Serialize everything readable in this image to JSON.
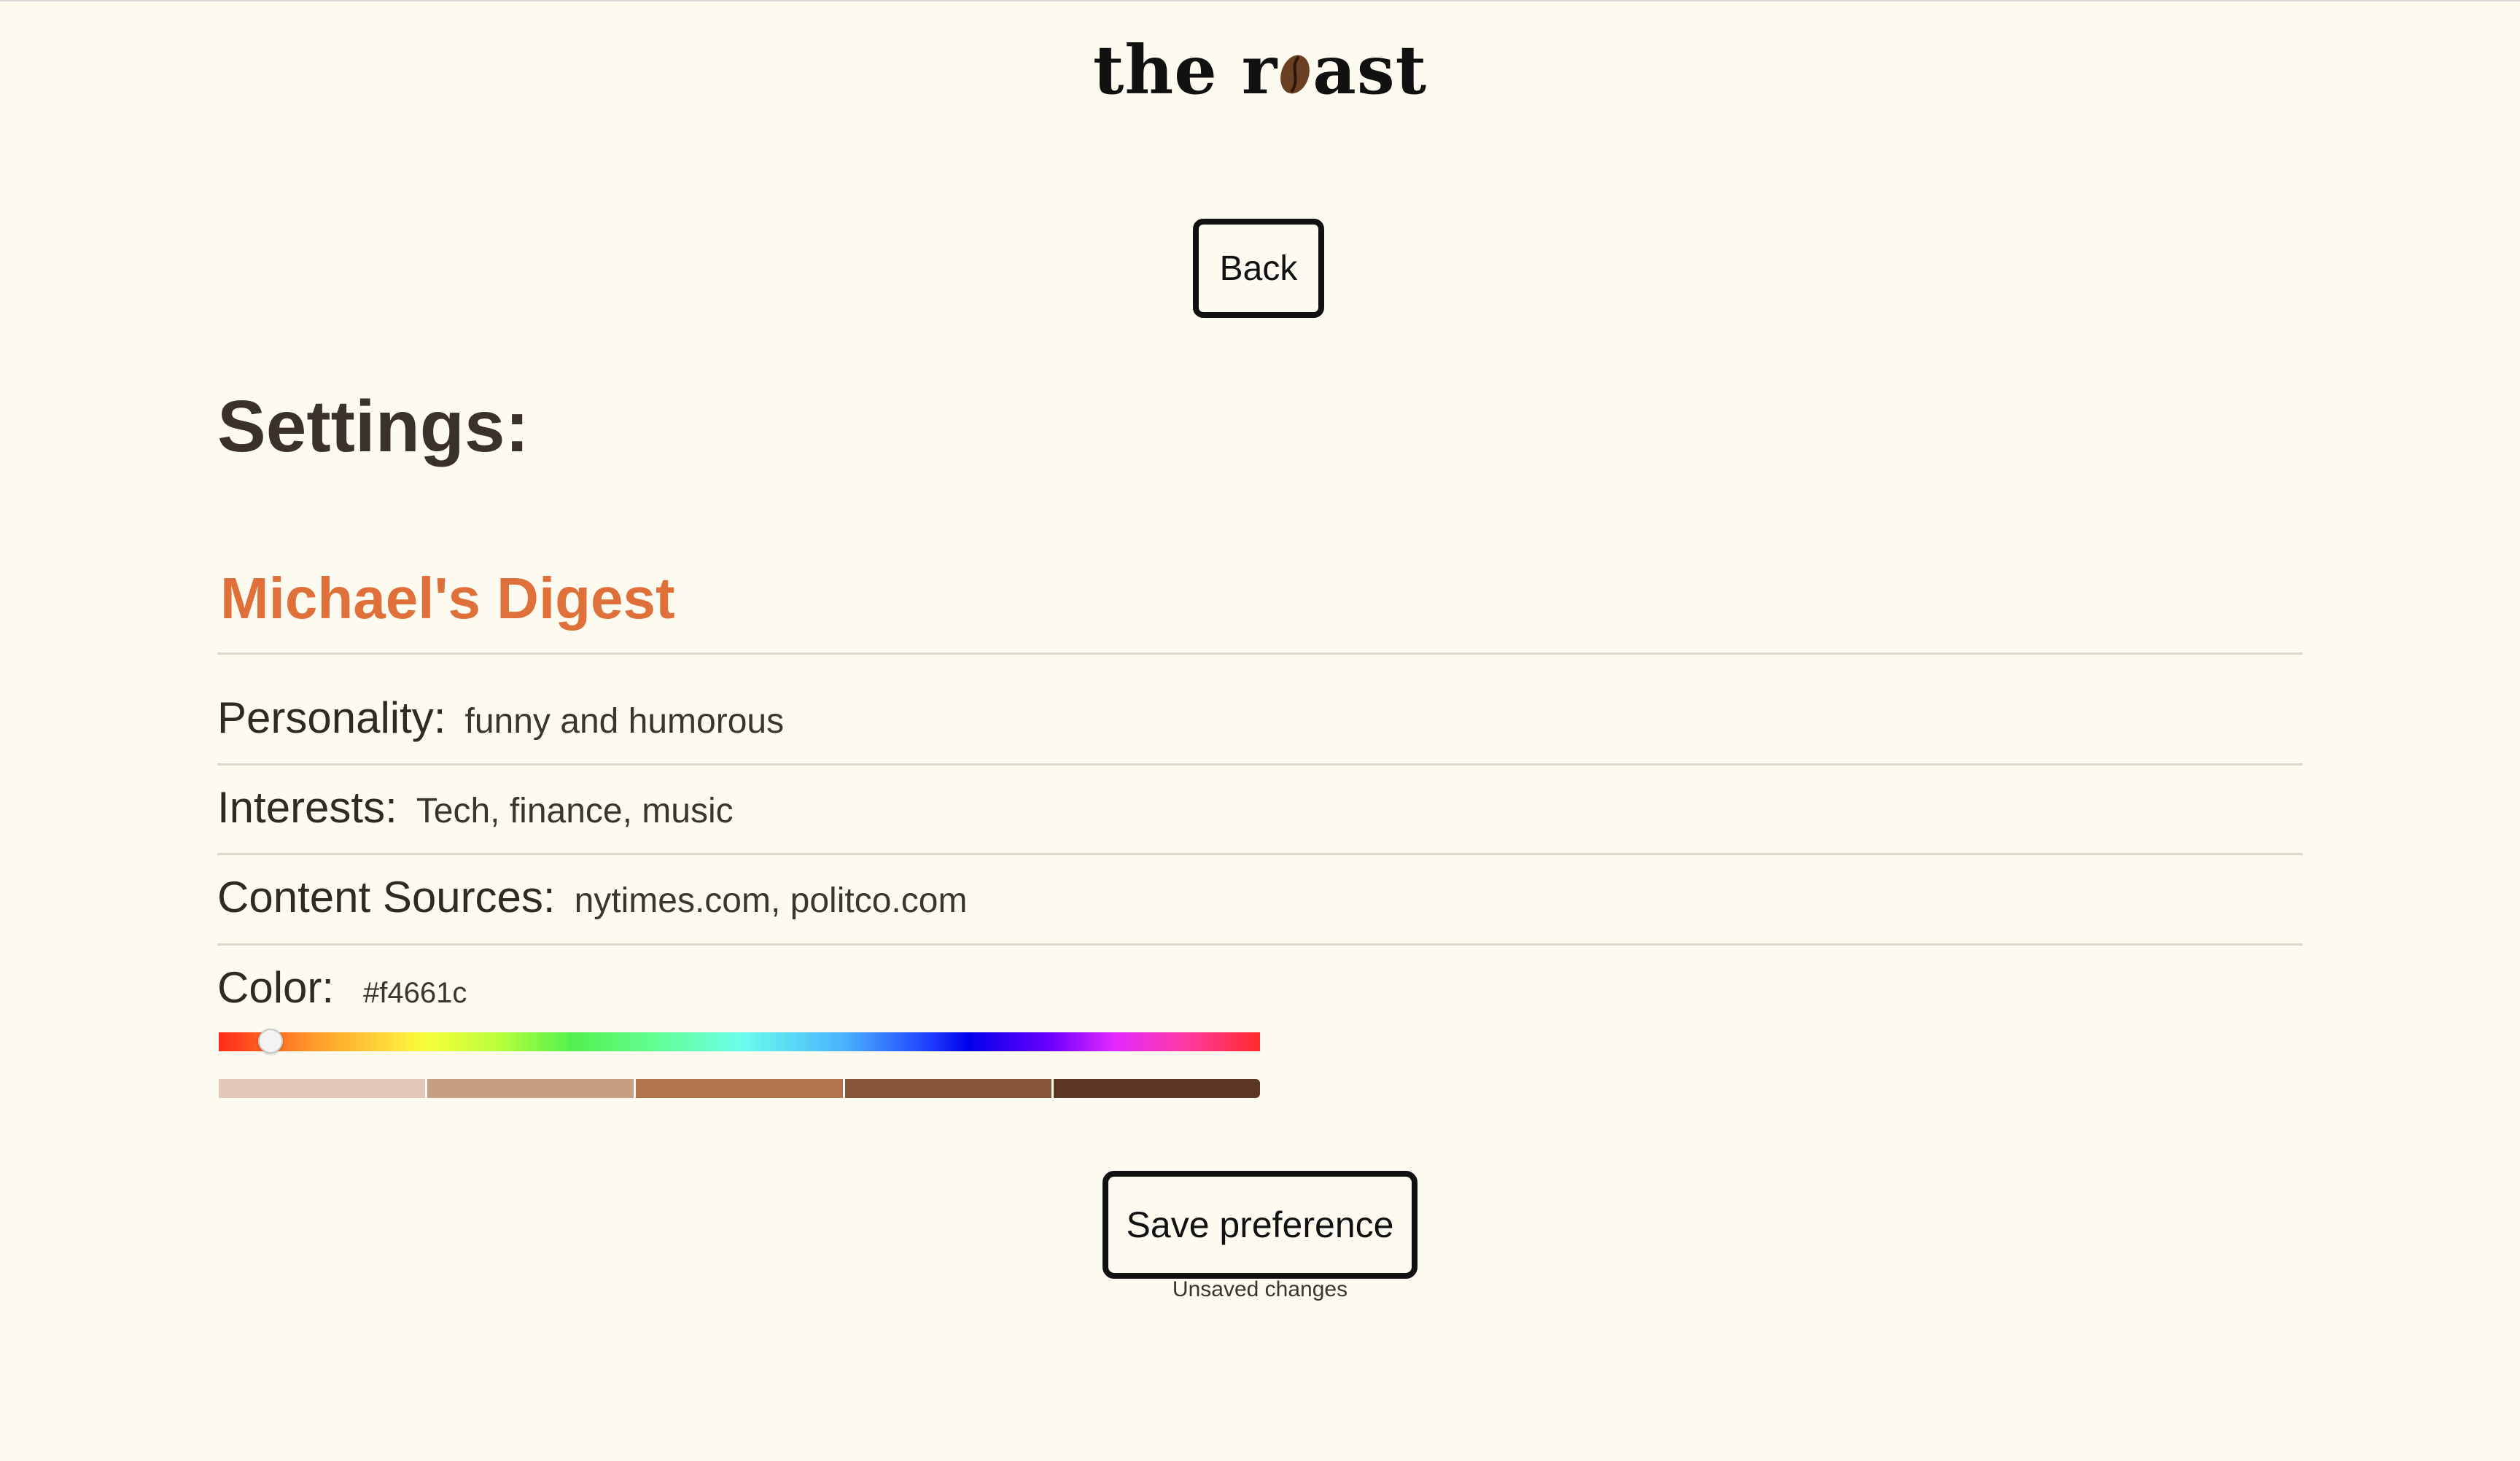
{
  "header": {
    "logo_left": "the r",
    "logo_right": "ast",
    "logo_icon": "coffee-bean-icon"
  },
  "nav": {
    "back_label": "Back"
  },
  "page": {
    "title": "Settings:"
  },
  "digest": {
    "title": "Michael's Digest",
    "title_color": "#e0703a"
  },
  "fields": {
    "personality": {
      "label": "Personality:",
      "value": "funny and humorous"
    },
    "interests": {
      "label": "Interests:",
      "value": "Tech, finance, music"
    },
    "sources": {
      "label": "Content Sources:",
      "value": "nytimes.com, politco.com"
    },
    "color": {
      "label": "Color:",
      "value": "#f4661c"
    }
  },
  "color_picker": {
    "hue_position": 0.05,
    "swatches": [
      "#e3c7b8",
      "#c89d85",
      "#b5734d",
      "#86553a",
      "#5a3625"
    ]
  },
  "actions": {
    "save_label": "Save preference",
    "status": "Unsaved changes"
  }
}
